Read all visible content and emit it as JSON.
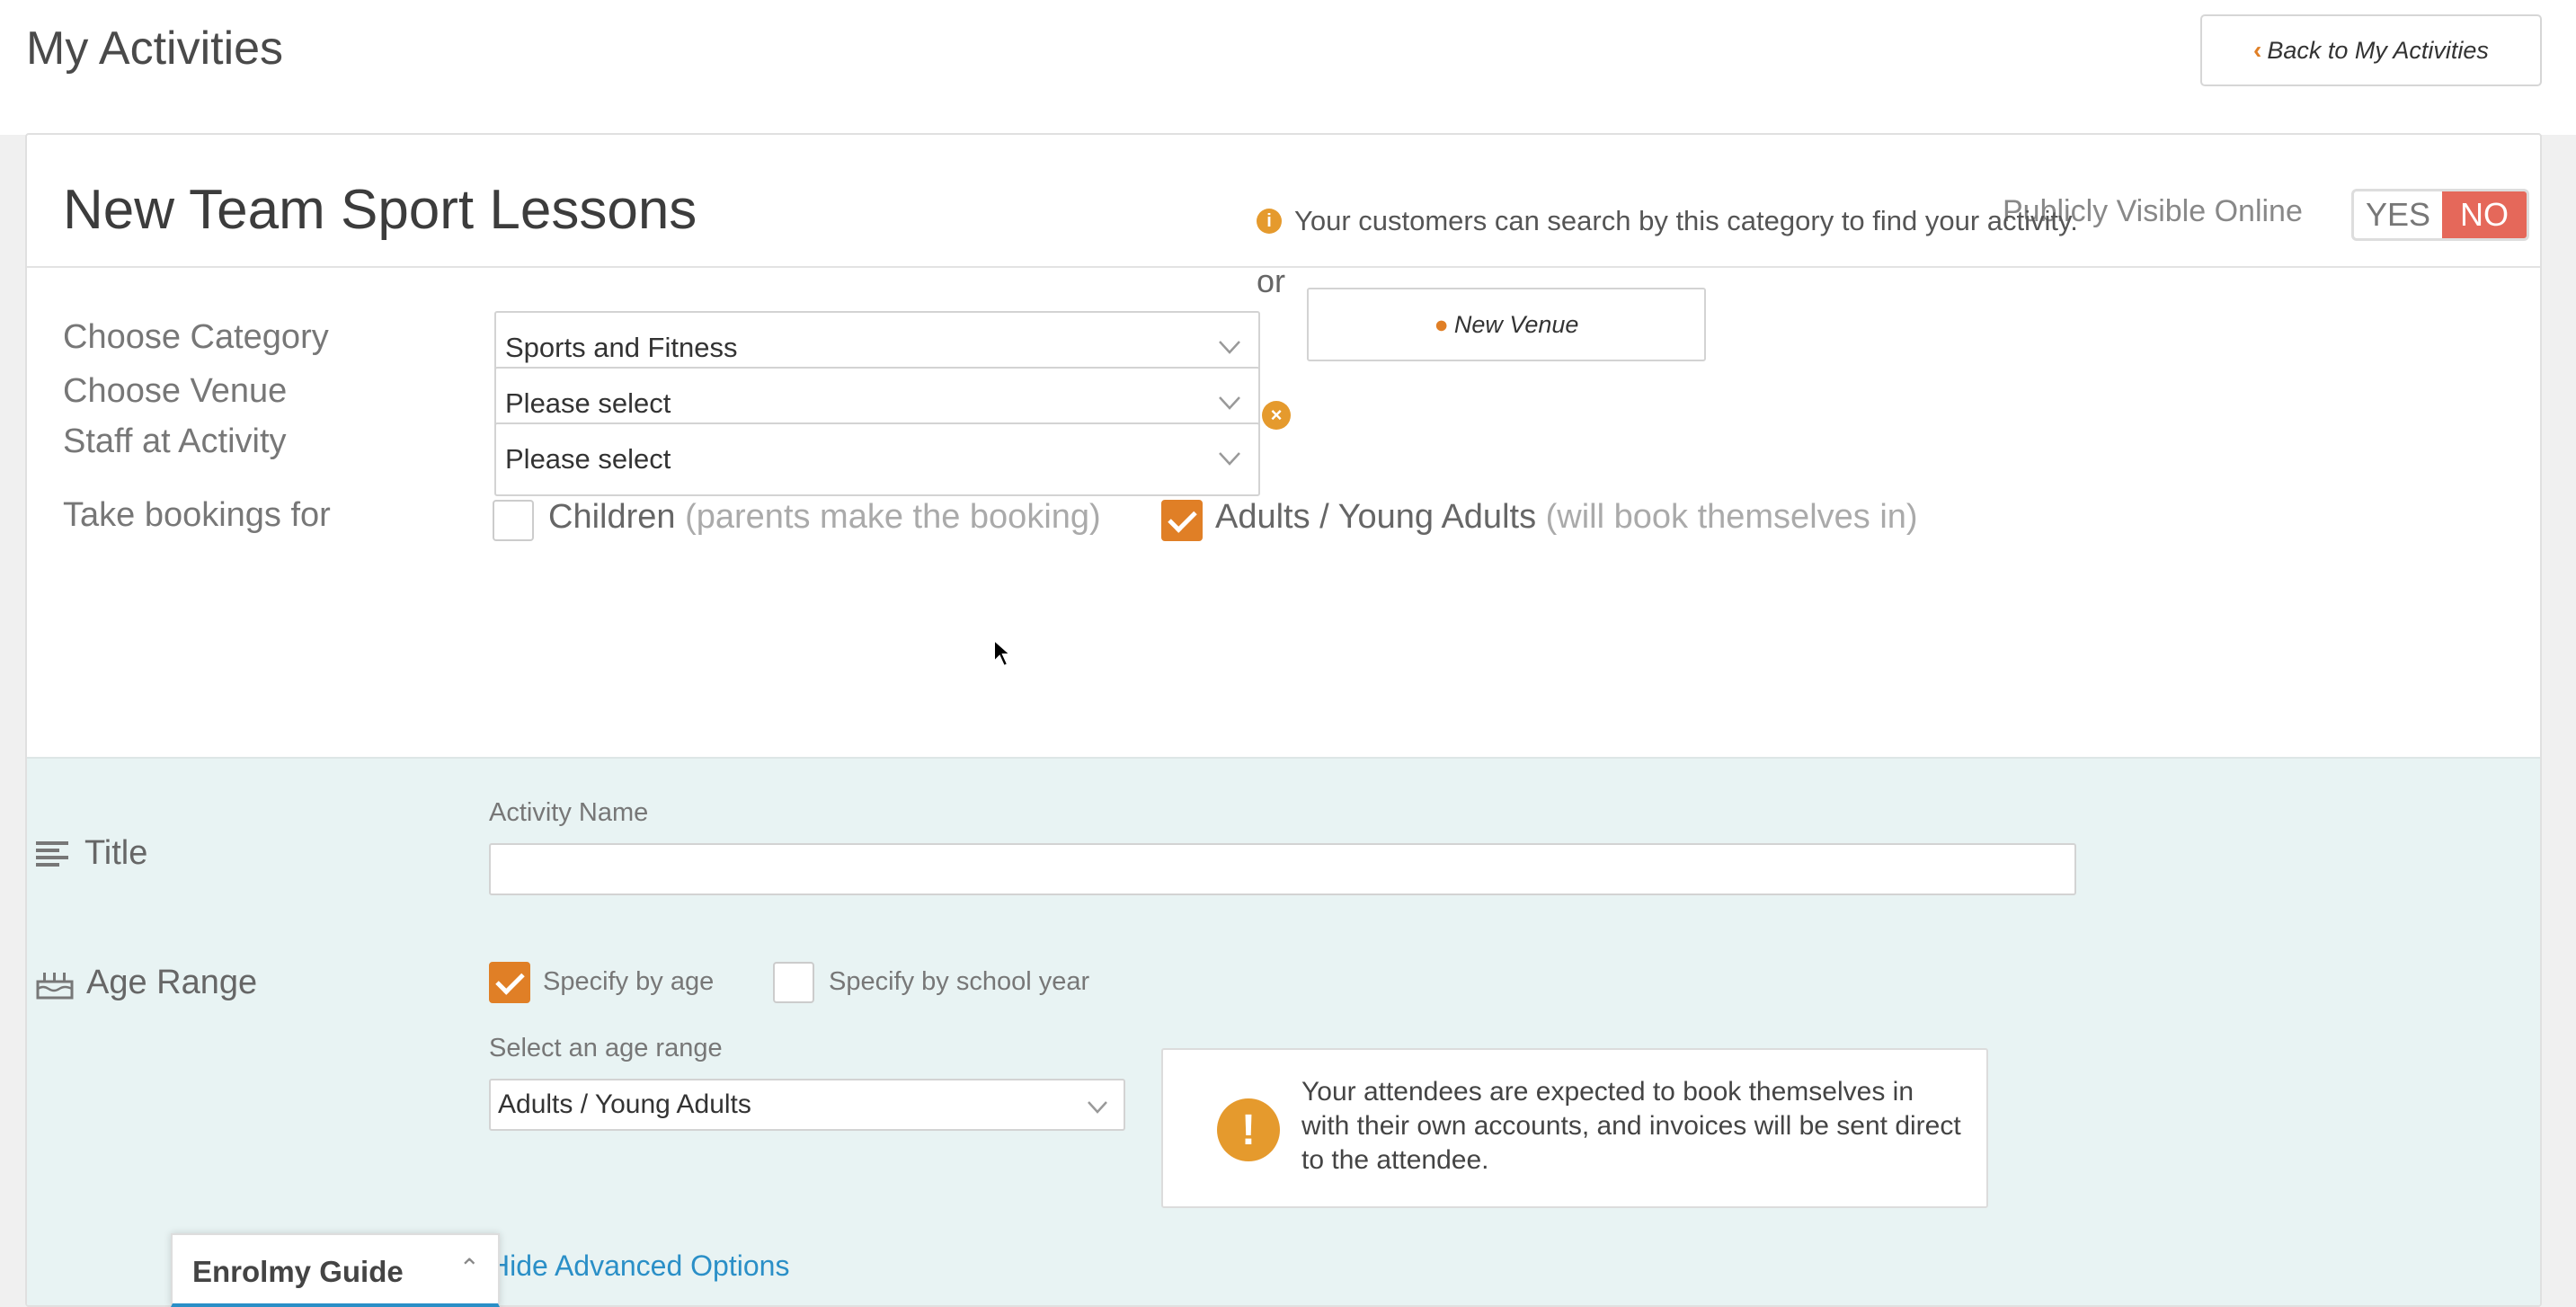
{
  "header": {
    "title": "My Activities",
    "back_label": "Back to My Activities",
    "back_icon": "chevron-left-icon"
  },
  "card": {
    "title": "New Team Sport Lessons",
    "visibility_label": "Publicly Visible Online",
    "toggle_yes": "YES",
    "toggle_no": "NO",
    "toggle_selected": "NO",
    "toggle_active_color": "#e5685a"
  },
  "form": {
    "category_label": "Choose Category",
    "category_value": "Sports and Fitness",
    "category_info": "Your customers can search by this category to find your activity.",
    "venue_label": "Choose Venue",
    "venue_value": "Please select",
    "or_text": "or",
    "new_venue_label": "New Venue",
    "staff_label": "Staff at Activity",
    "staff_value": "Please select",
    "bookings_label": "Take bookings for",
    "children_label": "Children",
    "children_sub": "(parents make the booking)",
    "children_checked": false,
    "adults_label": "Adults / Young Adults",
    "adults_sub": "(will book themselves in)",
    "adults_checked": true
  },
  "details": {
    "title_label": "Title",
    "activity_name_caption": "Activity Name",
    "activity_name_value": "",
    "age_label": "Age Range",
    "specify_age_label": "Specify by age",
    "specify_age_checked": true,
    "specify_year_label": "Specify by school year",
    "specify_year_checked": false,
    "age_range_caption": "Select an age range",
    "age_range_value": "Adults / Young Adults",
    "alert_text": "Your attendees are expected to book themselves in with their own accounts, and invoices will be sent direct to the attendee.",
    "advanced_link": "Hide Advanced Options"
  },
  "guide": {
    "title": "Enrolmy Guide"
  },
  "colors": {
    "accent": "#e07f26",
    "link": "#2a8fc7",
    "teal_bg": "#e8f3f3"
  }
}
